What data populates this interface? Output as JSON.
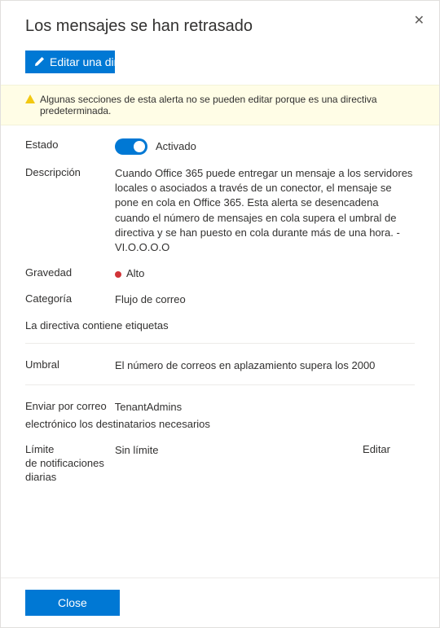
{
  "header": {
    "title": "Los mensajes se han retrasado",
    "edit_button": "Editar una directiva"
  },
  "warning": {
    "text": "Algunas secciones de esta alerta no se pueden editar porque es una directiva predeterminada."
  },
  "fields": {
    "status_label": "Estado",
    "status_value": "Activado",
    "description_label": "Descripción",
    "description_value": "Cuando Office 365 puede entregar un mensaje a los servidores locales o asociados a través de un conector, el mensaje se pone en cola en Office 365. Esta alerta se desencadena cuando el número de mensajes en cola supera el umbral de directiva y se han puesto en cola durante más de una hora. -VI.O.O.O.O",
    "severity_label": "Gravedad",
    "severity_value": "Alto",
    "severity_color": "#d13438",
    "category_label": "Categoría",
    "category_value": "Flujo de correo",
    "tags_label": "La directiva contiene etiquetas",
    "threshold_label": "Umbral",
    "threshold_value": "El número de correos en aplazamiento supera los 2000",
    "recipients_label_1": "Enviar por correo",
    "recipients_label_2": "electrónico los destinatarios necesarios",
    "recipients_value": "TenantAdmins",
    "limit_label_1": "Límite",
    "limit_label_2": "de notificaciones",
    "limit_label_3": "diarias",
    "limit_value": "Sin límite",
    "edit_link": "Editar"
  },
  "footer": {
    "close": "Close"
  }
}
